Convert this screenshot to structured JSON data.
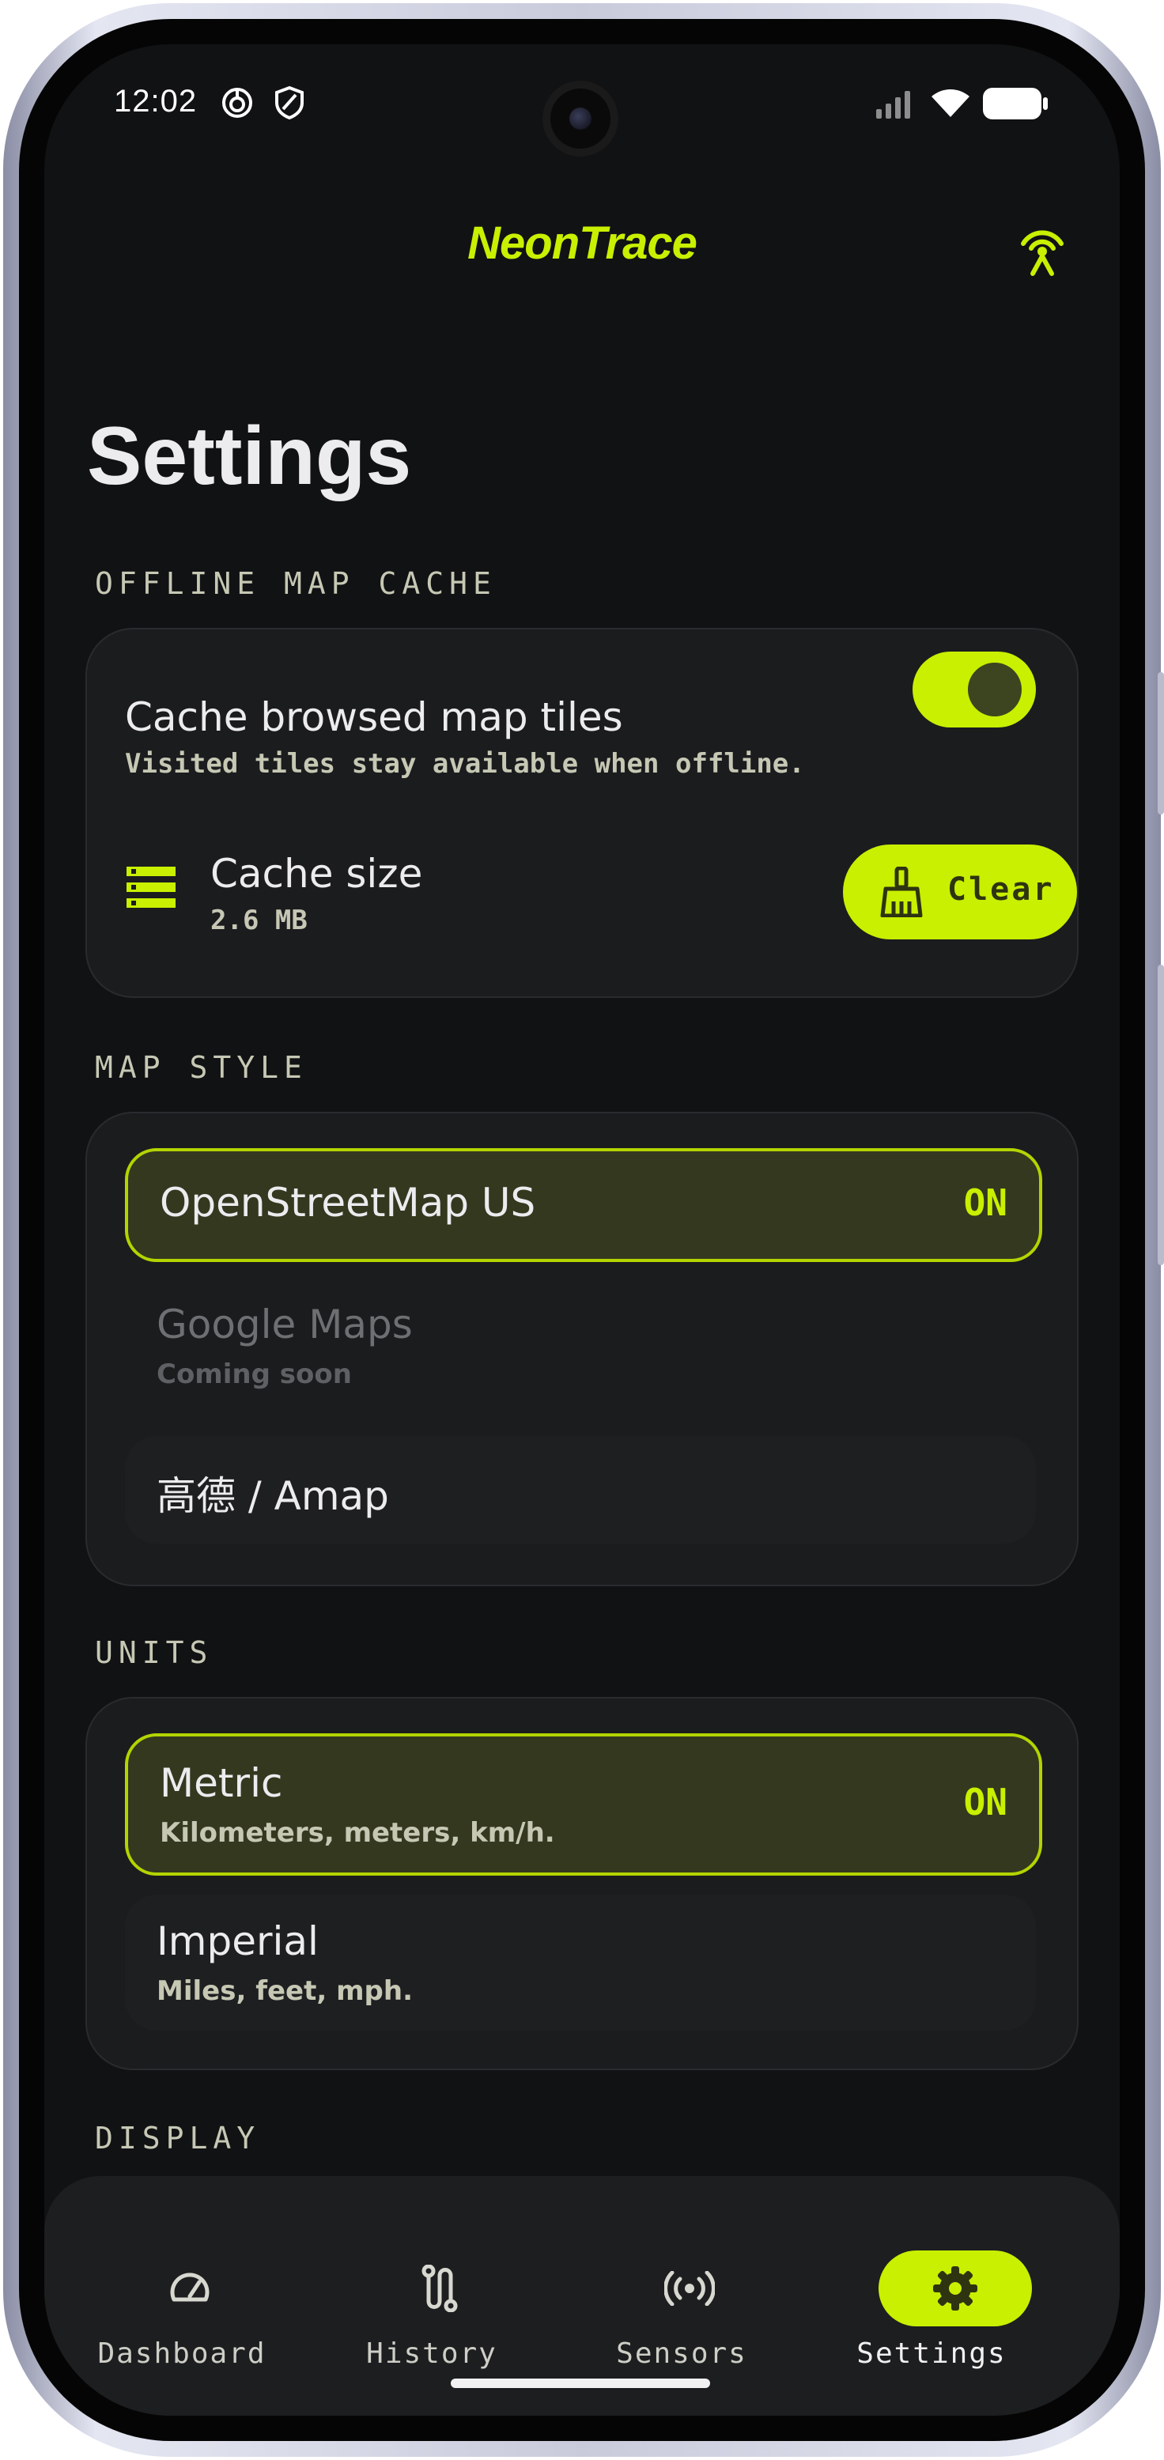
{
  "status_bar": {
    "time": "12:02"
  },
  "header": {
    "app_title": "NeonTrace"
  },
  "page": {
    "title": "Settings"
  },
  "offline_cache": {
    "section_label": "OFFLINE MAP CACHE",
    "toggle_title": "Cache browsed map tiles",
    "toggle_subtitle": "Visited tiles stay available when offline.",
    "toggle_on": true,
    "size_title": "Cache size",
    "size_value": "2.6 MB",
    "clear_label": "Clear"
  },
  "map_style": {
    "section_label": "MAP STYLE",
    "options": [
      {
        "title": "OpenStreetMap US",
        "state": "ON",
        "selected": true
      },
      {
        "title": "Google Maps",
        "subtitle": "Coming soon",
        "disabled": true
      },
      {
        "title": "高德 / Amap"
      }
    ]
  },
  "units": {
    "section_label": "UNITS",
    "options": [
      {
        "title": "Metric",
        "subtitle": "Kilometers, meters, km/h.",
        "state": "ON",
        "selected": true
      },
      {
        "title": "Imperial",
        "subtitle": "Miles, feet, mph."
      }
    ]
  },
  "display": {
    "section_label": "DISPLAY"
  },
  "bottom_nav": {
    "items": [
      {
        "label": "Dashboard",
        "icon": "gauge-icon"
      },
      {
        "label": "History",
        "icon": "route-icon"
      },
      {
        "label": "Sensors",
        "icon": "broadcast-icon"
      },
      {
        "label": "Settings",
        "icon": "gear-icon",
        "active": true
      }
    ]
  },
  "colors": {
    "accent": "#c8f000",
    "background": "#111214",
    "card": "#1b1c1e"
  }
}
